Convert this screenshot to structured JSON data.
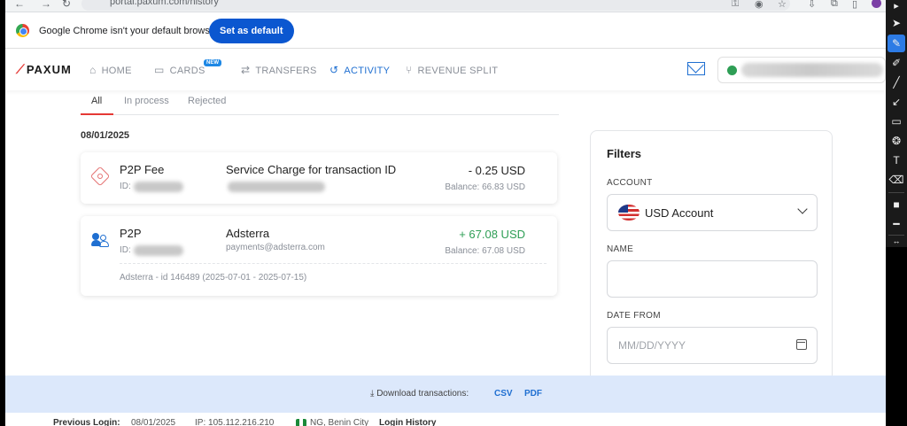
{
  "browser": {
    "url": "portal.paxum.com/history",
    "infobar_text": "Google Chrome isn't your default browser",
    "set_default_label": "Set as default"
  },
  "nav": {
    "logo": "PAXUM",
    "items": [
      {
        "label": "HOME",
        "icon": "home-icon"
      },
      {
        "label": "CARDS",
        "icon": "card-icon",
        "badge": "NEW"
      },
      {
        "label": "TRANSFERS",
        "icon": "transfer-icon"
      },
      {
        "label": "ACTIVITY",
        "icon": "history-icon"
      },
      {
        "label": "REVENUE SPLIT",
        "icon": "split-icon"
      }
    ],
    "accent": "#1f6fd1"
  },
  "tabs": [
    {
      "label": "All"
    },
    {
      "label": "In process"
    },
    {
      "label": "Rejected"
    }
  ],
  "date_heading": "08/01/2025",
  "transactions": [
    {
      "type": "P2P Fee",
      "id_label": "ID:",
      "description": "Service Charge for transaction ID",
      "amount": "- 0.25 USD",
      "balance": "Balance: 66.83 USD"
    },
    {
      "type": "P2P",
      "id_label": "ID:",
      "description": "Adsterra",
      "sub": "payments@adsterra.com",
      "amount": "+ 67.08 USD",
      "balance": "Balance: 67.08 USD",
      "note": "Adsterra - id 146489 (2025-07-01 - 2025-07-15)"
    }
  ],
  "filters": {
    "title": "Filters",
    "account_label": "ACCOUNT",
    "account_value": "USD Account",
    "name_label": "NAME",
    "name_value": "",
    "date_from_label": "DATE FROM",
    "date_from_placeholder": "MM/DD/YYYY"
  },
  "download": {
    "label": "Download transactions:",
    "csv": "CSV",
    "pdf": "PDF"
  },
  "previous_login": {
    "label": "Previous Login:",
    "date": "08/01/2025",
    "ip": "IP: 105.112.216.210",
    "location": "NG, Benin City",
    "history_link": "Login History"
  }
}
